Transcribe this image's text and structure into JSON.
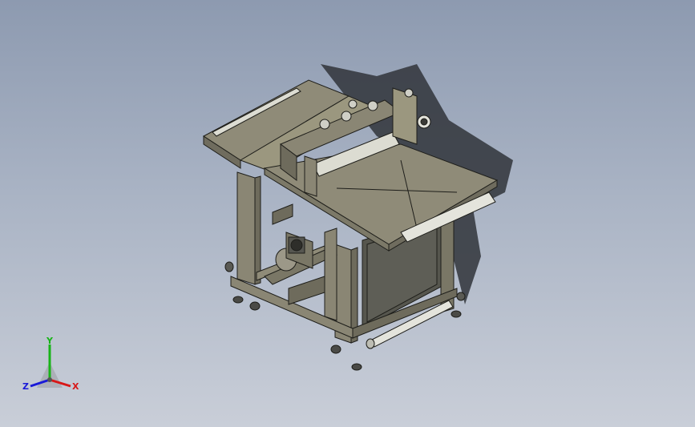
{
  "viewport": {
    "background_top": "#8d9ab0",
    "background_bottom": "#c9ced8",
    "model_face_color": "#8f8b78",
    "model_edge_color": "#1e1e1a"
  },
  "triad": {
    "x_label": "X",
    "y_label": "Y",
    "z_label": "Z",
    "x_color": "#d81818",
    "y_color": "#18b418",
    "z_color": "#1a1ad8"
  }
}
